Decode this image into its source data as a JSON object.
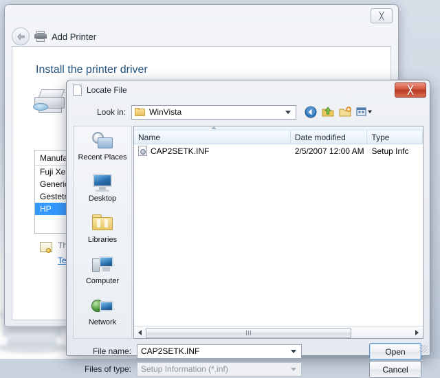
{
  "wizard": {
    "title": "Add Printer",
    "heading": "Install the printer driver",
    "close_label": "╳",
    "back_icon": "back-arrow-icon",
    "printer_icon": "printer-icon",
    "manufacturer_header": "Manufa",
    "manufacturers": [
      {
        "label": "Fuji Xer",
        "selected": false
      },
      {
        "label": "Generic",
        "selected": false
      },
      {
        "label": "Gestetn",
        "selected": false
      },
      {
        "label": "HP",
        "selected": true
      }
    ],
    "driver_signed_text": "Thi",
    "driver_signing_link": "Tell",
    "cert_icon": "certificate-icon"
  },
  "dialog": {
    "title": "Locate File",
    "title_icon": "file-icon",
    "close_label": "╳",
    "lookin": {
      "label": "Look in:",
      "value": "WinVista",
      "folder_icon": "folder-icon",
      "dropdown_icon": "chevron-down-icon"
    },
    "toolbar": [
      {
        "name": "back-button-icon",
        "title": "Back"
      },
      {
        "name": "up-one-level-icon",
        "title": "Up One Level"
      },
      {
        "name": "new-folder-icon",
        "title": "Create New Folder"
      },
      {
        "name": "views-icon",
        "title": "Views"
      }
    ],
    "places": [
      {
        "label": "Recent Places",
        "icon": "recent-places-icon"
      },
      {
        "label": "Desktop",
        "icon": "desktop-icon"
      },
      {
        "label": "Libraries",
        "icon": "libraries-icon"
      },
      {
        "label": "Computer",
        "icon": "computer-icon"
      },
      {
        "label": "Network",
        "icon": "network-icon"
      }
    ],
    "columns": [
      "Name",
      "Date modified",
      "Type"
    ],
    "files": [
      {
        "name": "CAP2SETK.INF",
        "date_modified": "2/5/2007 12:00 AM",
        "type": "Setup Infc",
        "icon": "inf-file-icon"
      }
    ],
    "filename": {
      "label": "File name:",
      "value": "CAP2SETK.INF"
    },
    "filetype": {
      "label": "Files of type:",
      "value": "Setup Information (*.inf)",
      "disabled": true
    },
    "buttons": {
      "open": "Open",
      "cancel": "Cancel"
    },
    "scrollbar": {
      "left_arrow": "scroll-left-arrow-icon",
      "right_arrow": "scroll-right-arrow-icon"
    }
  },
  "colors": {
    "heading_blue": "#23537e",
    "selection_blue": "#3399ff",
    "close_red": "#b83a22",
    "link_blue": "#0b63c6"
  }
}
